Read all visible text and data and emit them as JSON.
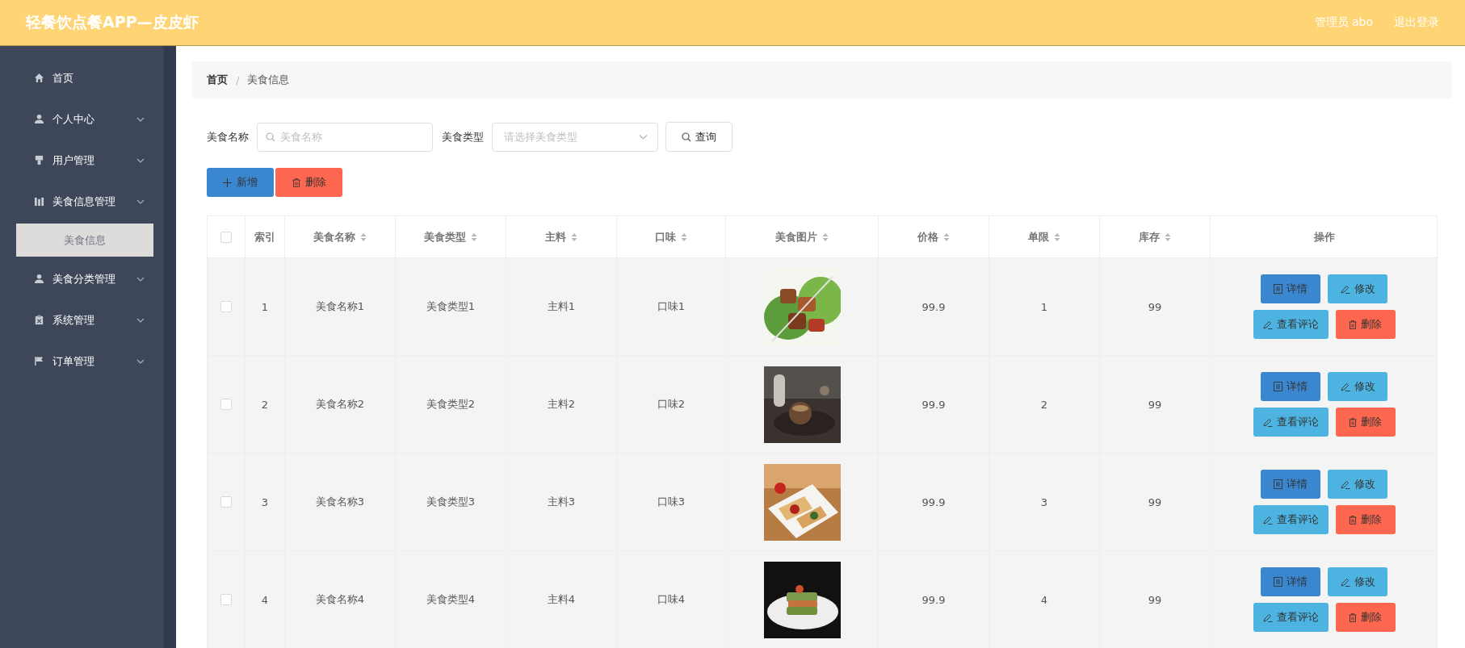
{
  "header": {
    "title": "轻餐饮点餐APP—皮皮虾",
    "user": "管理员 abo",
    "logout": "退出登录"
  },
  "sidebar": {
    "items": [
      {
        "label": "首页",
        "kind": "link",
        "selected": false
      },
      {
        "label": "个人中心",
        "kind": "menu",
        "selected": false
      },
      {
        "label": "用户管理",
        "kind": "menu",
        "selected": false
      },
      {
        "label": "美食信息管理",
        "kind": "menu",
        "selected": false,
        "children": [
          {
            "label": "美食信息",
            "selected": true
          }
        ]
      },
      {
        "label": "美食分类管理",
        "kind": "menu",
        "selected": false
      },
      {
        "label": "系统管理",
        "kind": "menu",
        "selected": false
      },
      {
        "label": "订单管理",
        "kind": "menu",
        "selected": false
      }
    ]
  },
  "breadcrumb": {
    "separator": "/",
    "items": [
      "首页",
      "美食信息"
    ]
  },
  "filters": [
    {
      "label": "美食名称",
      "kind": "text",
      "placeholder": "美食名称"
    },
    {
      "label": "美食类型",
      "kind": "select",
      "placeholder": "请选择美食类型"
    }
  ],
  "search_button": "查询",
  "actions": [
    {
      "label": "新增",
      "kind": "add"
    },
    {
      "label": "删除",
      "kind": "delete"
    }
  ],
  "table": {
    "select_all": {
      "checked": false
    },
    "columns": [
      {
        "label": "索引",
        "sortable": false
      },
      {
        "label": "美食名称",
        "sortable": true
      },
      {
        "label": "美食类型",
        "sortable": true
      },
      {
        "label": "主料",
        "sortable": true
      },
      {
        "label": "口味",
        "sortable": true
      },
      {
        "label": "美食图片",
        "sortable": true
      },
      {
        "label": "价格",
        "sortable": true
      },
      {
        "label": "单限",
        "sortable": true
      },
      {
        "label": "库存",
        "sortable": true
      },
      {
        "label": "操作",
        "sortable": false
      }
    ],
    "rows": [
      {
        "checked": false,
        "cells": [
          "1",
          "美食名称1",
          "美食类型1",
          "主料1",
          "口味1",
          {
            "kind": "picture"
          },
          "99.9",
          "1",
          "99"
        ],
        "buttons": [
          {
            "label": "详情",
            "kind": "detail"
          },
          {
            "label": "修改",
            "kind": "edit"
          },
          {
            "label": "查看评论",
            "kind": "comments"
          },
          {
            "label": "删除",
            "kind": "delete"
          }
        ]
      },
      {
        "checked": false,
        "cells": [
          "2",
          "美食名称2",
          "美食类型2",
          "主料2",
          "口味2",
          {
            "kind": "picture"
          },
          "99.9",
          "2",
          "99"
        ],
        "buttons": [
          {
            "label": "详情",
            "kind": "detail"
          },
          {
            "label": "修改",
            "kind": "edit"
          },
          {
            "label": "查看评论",
            "kind": "comments"
          },
          {
            "label": "删除",
            "kind": "delete"
          }
        ]
      },
      {
        "checked": false,
        "cells": [
          "3",
          "美食名称3",
          "美食类型3",
          "主料3",
          "口味3",
          {
            "kind": "picture"
          },
          "99.9",
          "3",
          "99"
        ],
        "buttons": [
          {
            "label": "详情",
            "kind": "detail"
          },
          {
            "label": "修改",
            "kind": "edit"
          },
          {
            "label": "查看评论",
            "kind": "comments"
          },
          {
            "label": "删除",
            "kind": "delete"
          }
        ]
      },
      {
        "checked": false,
        "cells": [
          "4",
          "美食名称4",
          "美食类型4",
          "主料4",
          "口味4",
          {
            "kind": "picture"
          },
          "99.9",
          "4",
          "99"
        ],
        "buttons": [
          {
            "label": "详情",
            "kind": "detail"
          },
          {
            "label": "修改",
            "kind": "edit"
          },
          {
            "label": "查看评论",
            "kind": "comments"
          },
          {
            "label": "删除",
            "kind": "delete"
          }
        ]
      }
    ]
  }
}
